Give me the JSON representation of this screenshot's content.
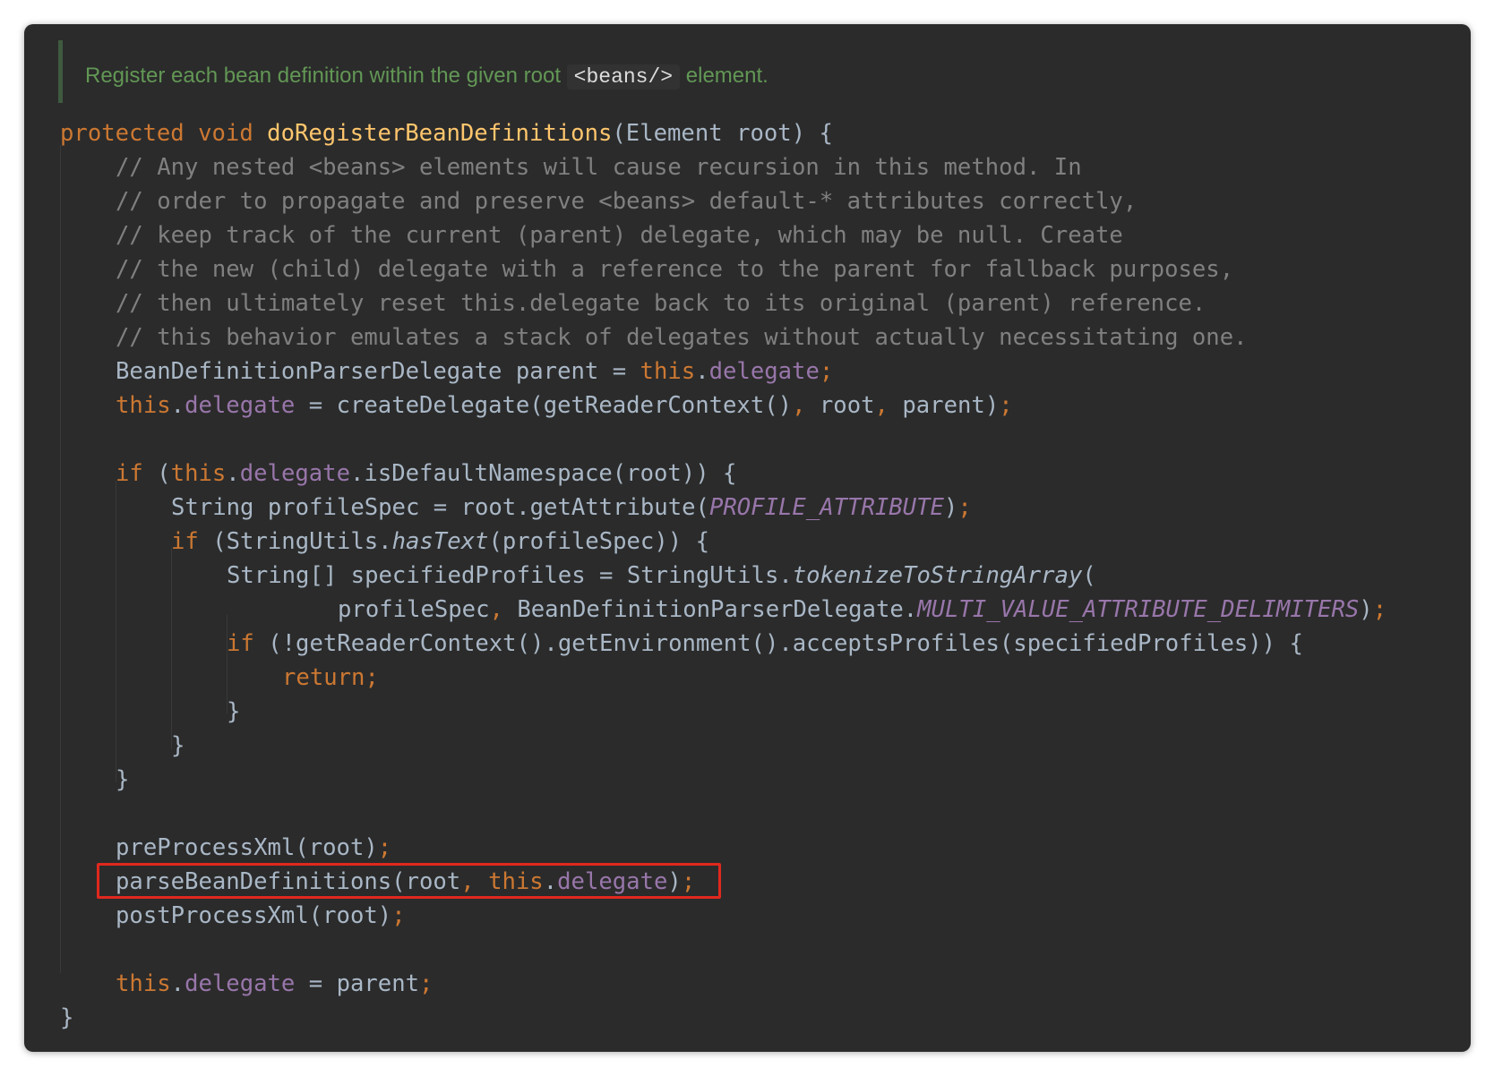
{
  "doc_comment": {
    "prefix": "Register each bean definition within the given root ",
    "code": "<beans/>",
    "suffix": " element."
  },
  "code": {
    "l1": {
      "kw1": "protected",
      "sp1": " ",
      "kw2": "void",
      "sp2": " ",
      "method": "doRegisterBeanDefinitions",
      "rest": "(Element root) {"
    },
    "c1": "// Any nested <beans> elements will cause recursion in this method. In",
    "c2": "// order to propagate and preserve <beans> default-* attributes correctly,",
    "c3": "// keep track of the current (parent) delegate, which may be null. Create",
    "c4": "// the new (child) delegate with a reference to the parent for fallback purposes,",
    "c5": "// then ultimately reset this.delegate back to its original (parent) reference.",
    "c6": "// this behavior emulates a stack of delegates without actually necessitating one.",
    "l8": {
      "a": "BeanDefinitionParserDelegate parent = ",
      "this": "this",
      "dot": ".",
      "field": "delegate",
      "semi": ";"
    },
    "l9": {
      "this": "this",
      "dot": ".",
      "field": "delegate",
      "b": " = createDelegate(getReaderContext()",
      "comma1": ",",
      "c": " root",
      "comma2": ",",
      "d": " parent)",
      "semi": ";"
    },
    "l11": {
      "if": "if",
      "a": " (",
      "this": "this",
      "dot": ".",
      "field": "delegate",
      "b": ".isDefaultNamespace(root)) {"
    },
    "l12": {
      "a": "String profileSpec = root.getAttribute(",
      "const": "PROFILE_ATTRIBUTE",
      "b": ")",
      "semi": ";"
    },
    "l13": {
      "if": "if",
      "a": " (StringUtils.",
      "static": "hasText",
      "b": "(profileSpec)) {"
    },
    "l14": {
      "a": "String[] specifiedProfiles = StringUtils.",
      "static": "tokenizeToStringArray",
      "b": "("
    },
    "l15": {
      "a": "profileSpec",
      "comma": ",",
      "b": " BeanDefinitionParserDelegate.",
      "const": "MULTI_VALUE_ATTRIBUTE_DELIMITERS",
      "c": ")",
      "semi": ";"
    },
    "l16": {
      "if": "if",
      "a": " (!getReaderContext().getEnvironment().acceptsProfiles(specifiedProfiles)) {"
    },
    "l17": {
      "ret": "return",
      "semi": ";"
    },
    "brace": "}",
    "l22": {
      "a": "preProcessXml(root)",
      "semi": ";"
    },
    "l23": {
      "a": "parseBeanDefinitions(root",
      "comma": ",",
      "sp": " ",
      "this": "this",
      "dot": ".",
      "field": "delegate",
      "b": ")",
      "semi": ";"
    },
    "l24": {
      "a": "postProcessXml(root)",
      "semi": ";"
    },
    "l26": {
      "this": "this",
      "dot": ".",
      "field": "delegate",
      "b": " = parent",
      "semi": ";"
    }
  },
  "colors": {
    "background": "#2b2b2b",
    "keyword": "#cc7832",
    "method": "#ffc66d",
    "field": "#9876aa",
    "comment": "#808080",
    "doc_comment": "#629755",
    "default_text": "#a9b7c6",
    "highlight_box": "#e0281e"
  }
}
